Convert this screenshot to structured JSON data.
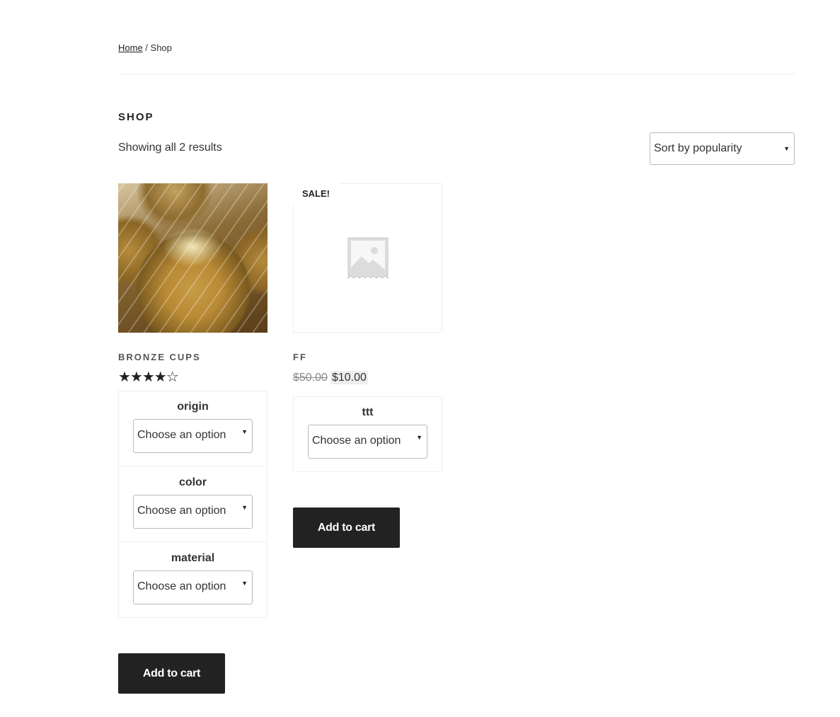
{
  "breadcrumb": {
    "home": "Home",
    "separator": " / ",
    "current": "Shop"
  },
  "page_title": "SHOP",
  "result_count": "Showing all 2 results",
  "sort": {
    "selected": "Sort by popularity"
  },
  "products": [
    {
      "name": "BRONZE CUPS",
      "image": "bronze-cups-photo",
      "rating": 4,
      "rating_max": 5,
      "stars": "★★★★☆",
      "variations": [
        {
          "label": "origin",
          "placeholder": "Choose an option"
        },
        {
          "label": "color",
          "placeholder": "Choose an option"
        },
        {
          "label": "material",
          "placeholder": "Choose an option"
        }
      ],
      "button": "Add to cart"
    },
    {
      "name": "FF",
      "image": "placeholder-image-icon",
      "badge": "SALE!",
      "price_old": "$50.00",
      "price_new": "$10.00",
      "variations": [
        {
          "label": "ttt",
          "placeholder": "Choose an option"
        }
      ],
      "button": "Add to cart"
    }
  ]
}
